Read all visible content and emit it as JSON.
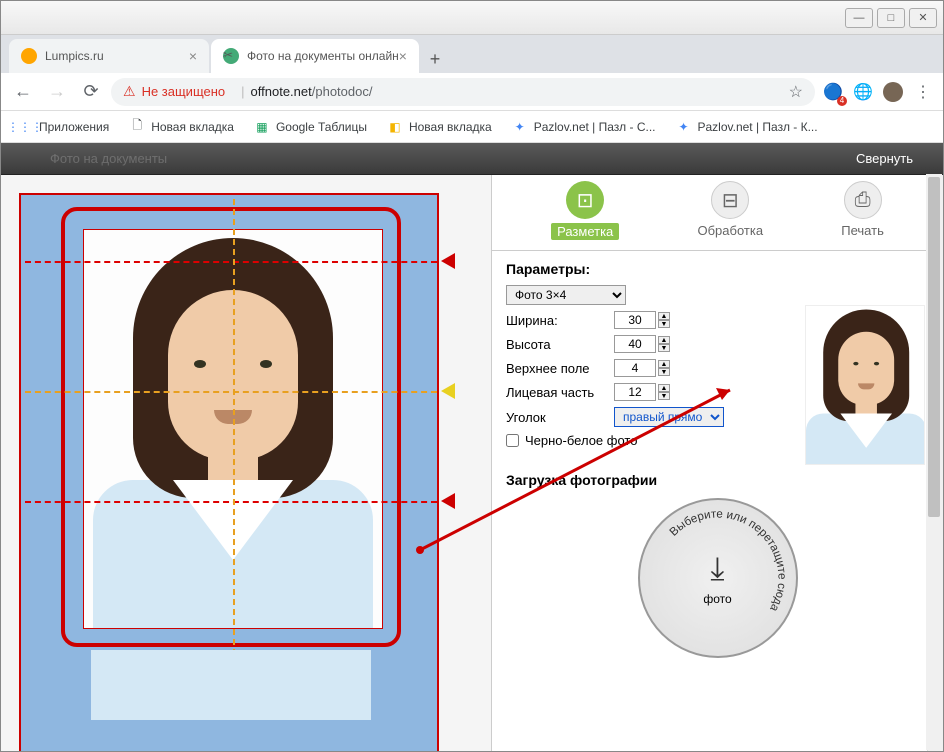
{
  "window": {
    "minimize": "—",
    "maximize": "□",
    "close": "✕"
  },
  "tabs": [
    {
      "title": "Lumpics.ru",
      "active": false
    },
    {
      "title": "Фото на документы онлайн",
      "active": true
    }
  ],
  "addressBar": {
    "insecureLabel": "Не защищено",
    "host": "offnote.net",
    "path": "/photodoc/"
  },
  "bookmarks": [
    {
      "label": "Приложения",
      "icon": "⋮⋮⋮"
    },
    {
      "label": "Новая вкладка",
      "icon": "🗋"
    },
    {
      "label": "Google Таблицы",
      "icon": "▦"
    },
    {
      "label": "Новая вкладка",
      "icon": "◧"
    },
    {
      "label": "Pazlov.net | Пазл - С...",
      "icon": "✦"
    },
    {
      "label": "Pazlov.net | Пазл - К...",
      "icon": "✦"
    }
  ],
  "pageHeader": {
    "faintTitle": "Фото на документы",
    "collapseLabel": "Свернуть"
  },
  "steps": [
    {
      "label": "Разметка",
      "icon": "◎",
      "active": true
    },
    {
      "label": "Обработка",
      "icon": "⚙",
      "active": false
    },
    {
      "label": "Печать",
      "icon": "🖶",
      "active": false
    }
  ],
  "params": {
    "title": "Параметры:",
    "presetLabel": "Фото 3×4",
    "width": {
      "label": "Ширина:",
      "value": "30"
    },
    "height": {
      "label": "Высота",
      "value": "40"
    },
    "topMargin": {
      "label": "Верхнее поле",
      "value": "4"
    },
    "facePart": {
      "label": "Лицевая часть",
      "value": "12"
    },
    "corner": {
      "label": "Уголок",
      "value": "правый прямой"
    },
    "bw": {
      "label": "Черно-белое фото",
      "checked": false
    }
  },
  "upload": {
    "title": "Загрузка фотографии",
    "circleText": "Выберите или перетащите сюда",
    "circleCenterText": "фото"
  }
}
